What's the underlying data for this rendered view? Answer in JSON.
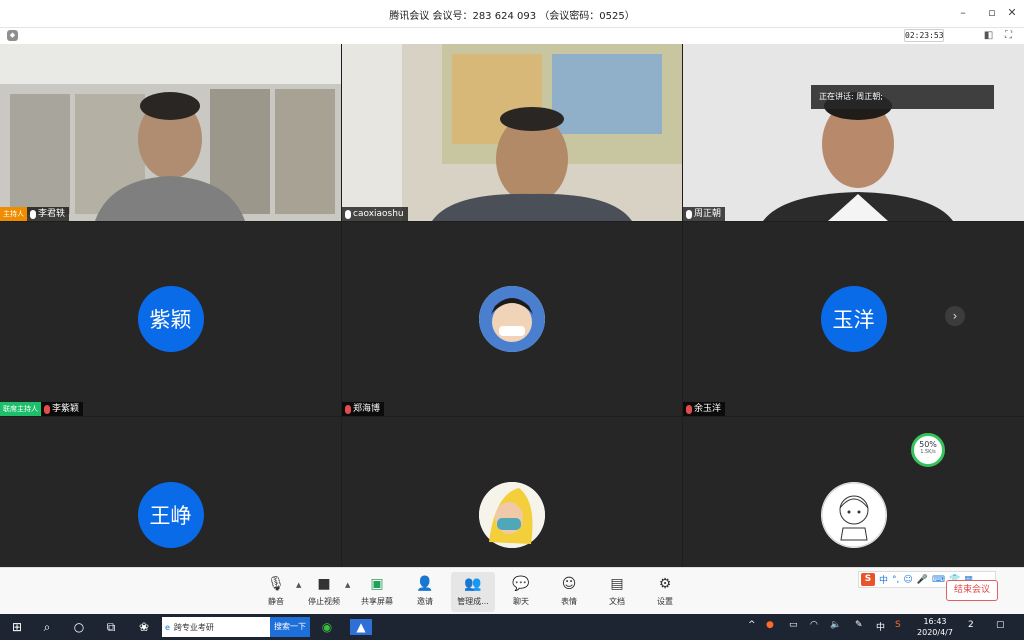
{
  "window": {
    "title": "腾讯会议 会议号：283 624 093 （会议密码：0525）",
    "timer": "02:23:53"
  },
  "speaking": "正在讲话: 周正朝;",
  "tiles": [
    {
      "name": "李君轶",
      "role": "主持人",
      "type": "video"
    },
    {
      "name": "caoxiaoshu",
      "type": "video"
    },
    {
      "name": "周正朝",
      "type": "video"
    },
    {
      "name": "李紫颖",
      "role": "联席主持人",
      "avatar_text": "紫颖",
      "type": "avatar"
    },
    {
      "name": "郑海博",
      "type": "avatar_image"
    },
    {
      "name": "余玉洋",
      "avatar_text": "玉洋",
      "type": "avatar"
    },
    {
      "avatar_text": "王峥",
      "type": "avatar"
    },
    {
      "type": "avatar_image"
    },
    {
      "type": "avatar_image"
    }
  ],
  "gauge": {
    "value": "50%",
    "rate": "1.5K/s"
  },
  "toolbar": [
    {
      "label": "静音",
      "icon": "microphone-icon"
    },
    {
      "label": "停止视频",
      "icon": "video-camera-icon"
    },
    {
      "label": "共享屏幕",
      "icon": "share-screen-icon"
    },
    {
      "label": "邀请",
      "icon": "invite-icon"
    },
    {
      "label": "管理成...",
      "icon": "members-icon"
    },
    {
      "label": "聊天",
      "icon": "chat-icon"
    },
    {
      "label": "表情",
      "icon": "emoji-icon"
    },
    {
      "label": "文档",
      "icon": "document-icon"
    },
    {
      "label": "设置",
      "icon": "settings-icon"
    }
  ],
  "end_button": "结束会议",
  "ime": {
    "s": "S",
    "lang": "中"
  },
  "taskbar": {
    "search_text": "跨专业考研",
    "search_button": "搜索一下",
    "time": "16:43",
    "date": "2020/4/7",
    "ime_lang": "中",
    "notification_count": "2"
  }
}
